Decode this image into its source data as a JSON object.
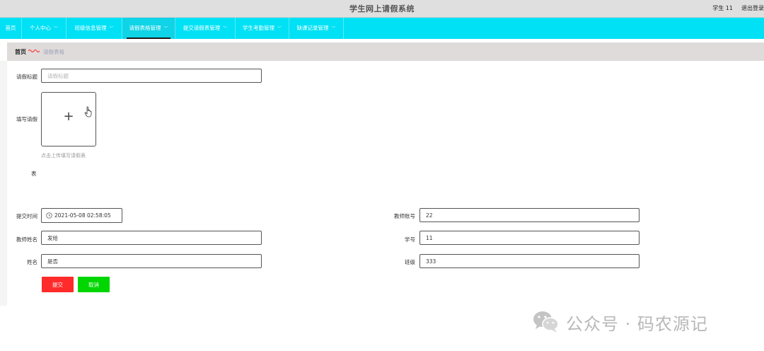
{
  "header": {
    "title": "学生网上请假系统",
    "user": "学生 11",
    "logout": "退出登录"
  },
  "nav": {
    "items": [
      {
        "label": "首页",
        "has_dropdown": false
      },
      {
        "label": "个人中心",
        "has_dropdown": true
      },
      {
        "label": "班级信息管理",
        "has_dropdown": true
      },
      {
        "label": "请假表格管理",
        "has_dropdown": true,
        "active": true
      },
      {
        "label": "提交请假表管理",
        "has_dropdown": true
      },
      {
        "label": "学生考勤管理",
        "has_dropdown": true
      },
      {
        "label": "缺课记录管理",
        "has_dropdown": true
      }
    ],
    "color": "#00e1f5"
  },
  "breadcrumb": {
    "home": "首页",
    "current": "请假表格"
  },
  "form": {
    "title_label": "请假标题",
    "title_placeholder": "请假标题",
    "upload_label": "填写请假",
    "upload_label_extra": "表",
    "upload_hint": "点击上传填写请假表",
    "submit_time_label": "提交时间",
    "submit_time_value": "2021-05-08 02:58:05",
    "teacher_account_label": "教师账号",
    "teacher_account_value": "22",
    "teacher_name_label": "教师姓名",
    "teacher_name_value": "发给",
    "student_id_label": "学号",
    "student_id_value": "11",
    "name_label": "姓名",
    "name_value": "是否",
    "class_label": "班级",
    "class_value": "333"
  },
  "buttons": {
    "submit": "提交",
    "cancel": "取消",
    "submit_color": "#ff2a2a",
    "cancel_color": "#00d600"
  },
  "watermark": {
    "text": "公众号 · 码农源记"
  }
}
